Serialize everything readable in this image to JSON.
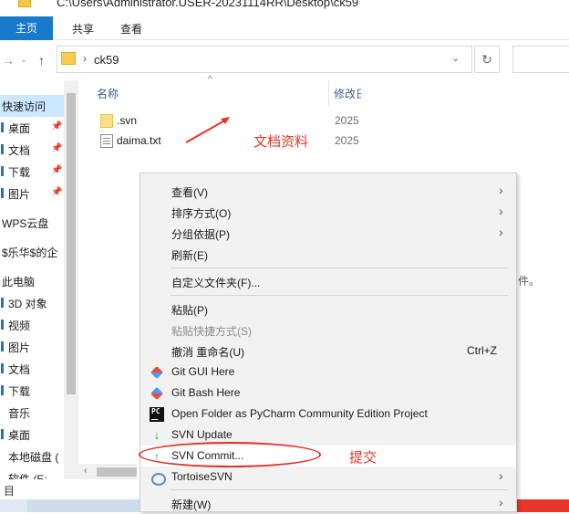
{
  "window": {
    "title": "C:\\Users\\Administrator.USER-20231114RR\\Desktop\\ck59"
  },
  "ribbon": {
    "tabs": [
      "主页",
      "共享",
      "查看"
    ],
    "active_label": "",
    "accent": "#1979ca"
  },
  "address": {
    "path": "ck59"
  },
  "nav": {
    "items": [
      {
        "label": "快速访问",
        "selected": true
      },
      {
        "label": "桌面",
        "pinned": true
      },
      {
        "label": "文档",
        "pinned": true
      },
      {
        "label": "下载",
        "pinned": true
      },
      {
        "label": "图片",
        "pinned": true
      },
      {
        "label": "WPS云盘"
      },
      {
        "label": "$乐华$的企"
      },
      {
        "label": "此电脑"
      },
      {
        "label": "3D 对象"
      },
      {
        "label": "视频"
      },
      {
        "label": "图片"
      },
      {
        "label": "文档"
      },
      {
        "label": "下载"
      },
      {
        "label": "音乐"
      },
      {
        "label": "桌面"
      },
      {
        "label": "本地磁盘 ("
      },
      {
        "label": "软件 (E:"
      }
    ]
  },
  "columns": {
    "name": "名称",
    "date": "修改日"
  },
  "files": [
    {
      "name": ".svn",
      "date": "2025",
      "type": "folder"
    },
    {
      "name": "daima.txt",
      "date": "2025",
      "type": "txt"
    }
  ],
  "annotations": {
    "doc_label": "文档资料",
    "commit_label": "提交",
    "color": "#e5352a"
  },
  "trailing_text": "件。",
  "status": {
    "count": "目"
  },
  "context_menu": {
    "items": [
      {
        "label": "查看(V)",
        "submenu": true
      },
      {
        "label": "排序方式(O)",
        "submenu": true
      },
      {
        "label": "分组依据(P)",
        "submenu": true
      },
      {
        "label": "刷新(E)"
      },
      {
        "label": "自定义文件夹(F)..."
      },
      {
        "label": "粘贴(P)"
      },
      {
        "label": "粘贴快捷方式(S)",
        "disabled": true
      },
      {
        "label": "撤消 重命名(U)",
        "shortcut": "Ctrl+Z"
      },
      {
        "label": "Git GUI Here",
        "icon": "git-gui-icon"
      },
      {
        "label": "Git Bash Here",
        "icon": "git-bash-icon"
      },
      {
        "label": "Open Folder as PyCharm Community Edition Project",
        "icon": "pycharm-icon",
        "icon_text": "PC"
      },
      {
        "label": "SVN Update",
        "icon": "svn-update-icon"
      },
      {
        "label": "SVN Commit...",
        "icon": "svn-commit-icon",
        "highlighted": true
      },
      {
        "label": "TortoiseSVN",
        "icon": "tortoisesvn-icon",
        "submenu": true
      },
      {
        "label": "新建(W)",
        "submenu": true
      }
    ]
  }
}
